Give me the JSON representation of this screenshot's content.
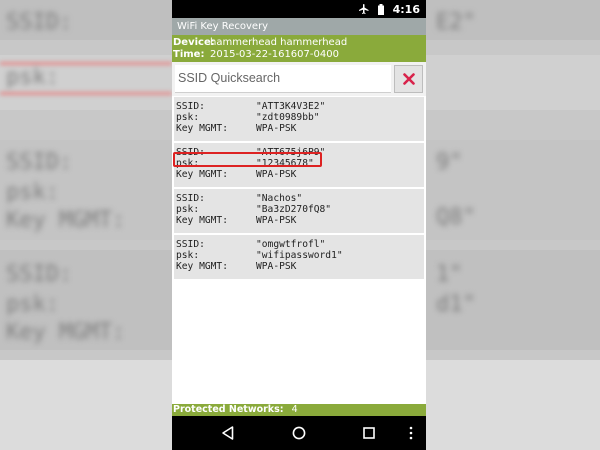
{
  "app": {
    "title": "WiFi Key Recovery"
  },
  "statusbar": {
    "time": "4:16",
    "icons": [
      "airplane-icon",
      "battery-icon"
    ]
  },
  "device_info": {
    "device_label": "Device:",
    "device_value": "hammerhead hammerhead",
    "time_label": "Time:",
    "time_value": "2015-03-22-161607-0400"
  },
  "search": {
    "placeholder": "SSID Quicksearch",
    "clear_icon": "close-icon",
    "clear_color": "#d8234b"
  },
  "labels": {
    "ssid": "SSID:",
    "psk": "psk:",
    "key_mgmt": "Key MGMT:"
  },
  "networks": [
    {
      "ssid": "\"ATT3K4V3E2\"",
      "psk": "\"zdt0989bb\"",
      "key_mgmt": "WPA-PSK"
    },
    {
      "ssid": "\"ATT675j6P9\"",
      "psk": "\"12345678\"",
      "key_mgmt": "WPA-PSK",
      "highlighted": true
    },
    {
      "ssid": "\"Nachos\"",
      "psk": "\"Ba3zD270fQ8\"",
      "key_mgmt": "WPA-PSK"
    },
    {
      "ssid": "\"omgwtfrofl\"",
      "psk": "\"wifipassword1\"",
      "key_mgmt": "WPA-PSK"
    }
  ],
  "footer": {
    "label": "Protected Networks:",
    "count": "4"
  },
  "colors": {
    "accent_green": "#8aaa3b",
    "appbar_gray": "#9fa8a8",
    "highlight_red": "#dd2222"
  },
  "navbar": {
    "buttons": [
      "back-icon",
      "home-icon",
      "recents-icon",
      "overflow-menu-icon"
    ]
  }
}
